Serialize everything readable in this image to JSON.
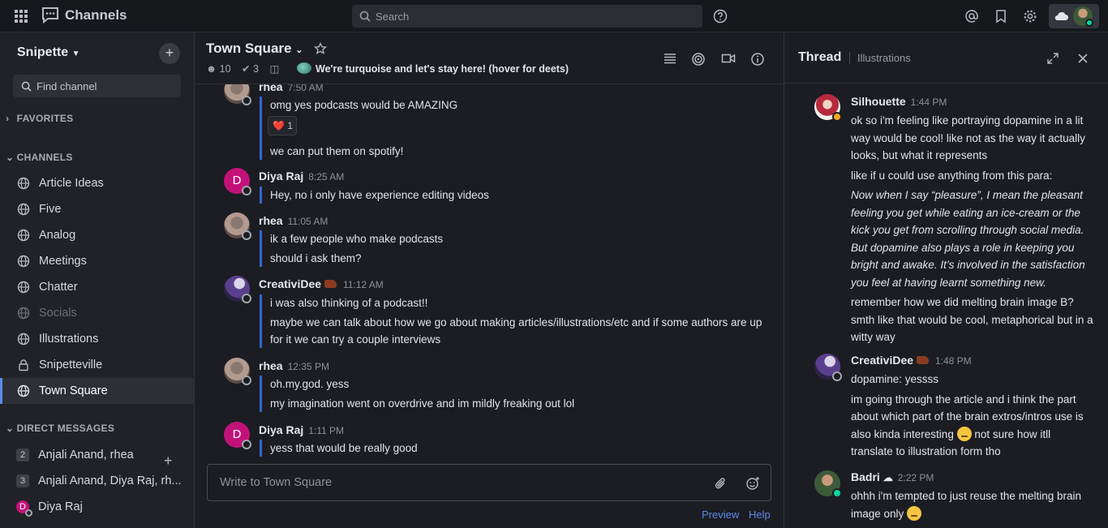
{
  "topbar": {
    "app_title": "Channels",
    "search_placeholder": "Search"
  },
  "sidebar": {
    "team_name": "Snipette",
    "find_channel": "Find channel",
    "favorites_label": "FAVORITES",
    "channels_label": "CHANNELS",
    "channels": [
      {
        "label": "Article Ideas",
        "icon": "globe-icon"
      },
      {
        "label": "Five",
        "icon": "globe-icon"
      },
      {
        "label": "Analog",
        "icon": "globe-icon"
      },
      {
        "label": "Meetings",
        "icon": "globe-icon"
      },
      {
        "label": "Chatter",
        "icon": "globe-icon"
      },
      {
        "label": "Socials",
        "icon": "globe-icon",
        "muted": true
      },
      {
        "label": "Illustrations",
        "icon": "globe-icon"
      },
      {
        "label": "Snipetteville",
        "icon": "lock-icon"
      },
      {
        "label": "Town Square",
        "icon": "globe-icon",
        "active": true
      }
    ],
    "dm_label": "DIRECT MESSAGES",
    "dms": [
      {
        "badge": "2",
        "label": "Anjali Anand, rhea"
      },
      {
        "badge": "3",
        "label": "Anjali Anand, Diya Raj, rh..."
      },
      {
        "badge": "D",
        "label": "Diya Raj"
      }
    ]
  },
  "channel": {
    "name": "Town Square",
    "members": "10",
    "pinned": "3",
    "purpose": "We're turquoise and let's stay here! (hover for deets)"
  },
  "messages": [
    {
      "user": "rhea",
      "time": "7:50 AM",
      "lines": [
        "omg yes podcasts would be AMAZING"
      ],
      "reaction": {
        "emoji": "❤️",
        "count": "1"
      },
      "after": "we can put them on spotify!"
    },
    {
      "user": "Diya Raj",
      "time": "8:25 AM",
      "lines": [
        "Hey, no i only have experience editing videos"
      ]
    },
    {
      "user": "rhea",
      "time": "11:05 AM",
      "lines": [
        "ik a few people who make podcasts",
        "should i ask them?"
      ]
    },
    {
      "user": "CreativiDee",
      "time": "11:12 AM",
      "lines": [
        "i was also thinking of a podcast!!",
        "maybe we can talk about how we go about making articles/illustrations/etc and if some authors are up for it we can try a couple interviews"
      ]
    },
    {
      "user": "rhea",
      "time": "12:35 PM",
      "lines": [
        "oh.my.god. yess",
        "my imagination went on overdrive and im mildly freaking out lol"
      ]
    },
    {
      "user": "Diya Raj",
      "time": "1:11 PM",
      "lines": [
        "yess that would be really good"
      ]
    }
  ],
  "composer": {
    "placeholder": "Write to Town Square",
    "preview": "Preview",
    "help": "Help"
  },
  "thread": {
    "title": "Thread",
    "channel": "Illustrations",
    "posts": [
      {
        "user": "Silhouette",
        "time": "1:44 PM",
        "p1": "ok so i'm feeling like portraying dopamine in a lit way would be cool! like not as the way it actually looks, but what it represents",
        "p2": "like if u could use anything from this para:",
        "quote": "Now when I say “pleasure”, I mean the pleasant feeling you get while eating an ice-cream or the kick you get from scrolling through social media. But dopamine also plays a role in keeping you bright and awake. It’s involved in the satisfaction you feel at having learnt something new.",
        "p3": "remember how we did melting brain image B?",
        "p4": "smth like that would be cool, metaphorical but in a witty way"
      },
      {
        "user": "CreativiDee",
        "time": "1:48 PM",
        "p1": "dopamine: yessss",
        "p2a": "im going through the article and i think the part about which part of the brain extros/intros use is also kinda interesting",
        "p2b": "not sure how itll translate to illustration form tho"
      },
      {
        "user": "Badri",
        "time": "2:22 PM",
        "p1": "ohhh i'm tempted to just reuse the melting brain image only"
      }
    ]
  },
  "colors": {
    "accent": "#5d89ea",
    "online": "#06d6a0",
    "mention_bar": "#3567ce"
  }
}
